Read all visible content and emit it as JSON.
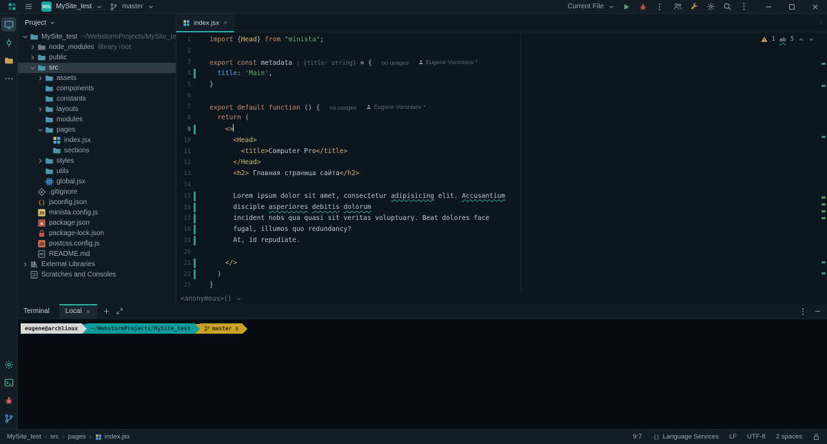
{
  "theme": {
    "accent": "#2BA9A2",
    "selection": "#2B3C46",
    "warning": "#D6AE58",
    "vcs_change": "#35948A",
    "typo_underline": "#3F9C8A"
  },
  "titlebar": {
    "left_icons": [
      {
        "name": "app-logo",
        "icon": "applogo",
        "color": "#2BA9A2"
      },
      {
        "name": "main-menu",
        "icon": "hamburger",
        "color": "#8C98A0"
      }
    ],
    "avatar": "MS",
    "project_name": "MySite_test",
    "branch": "master",
    "run_config": "Current File",
    "run_icons": [
      {
        "name": "run",
        "icon": "play",
        "color": "#4EA07C"
      },
      {
        "name": "debug",
        "icon": "bug",
        "color": "#C75450"
      },
      {
        "name": "run-more",
        "icon": "kebab",
        "color": "#8C98A0"
      }
    ],
    "right_icons": [
      {
        "name": "code-with-me",
        "icon": "users",
        "color": "#8C98A0"
      },
      {
        "name": "services",
        "icon": "wrench",
        "color": "#C78A3B"
      },
      {
        "name": "settings",
        "icon": "gear",
        "color": "#8C98A0"
      },
      {
        "name": "search-everywhere",
        "icon": "search",
        "color": "#8C98A0"
      },
      {
        "name": "more-actions",
        "icon": "kebab",
        "color": "#8C98A0"
      }
    ],
    "window_icons": [
      {
        "name": "minimize",
        "icon": "minus",
        "color": "#9AA6AE"
      },
      {
        "name": "maximize",
        "icon": "square",
        "color": "#9AA6AE"
      },
      {
        "name": "close-window",
        "icon": "close",
        "color": "#9AA6AE"
      }
    ]
  },
  "tool_stripe": {
    "top": [
      {
        "name": "project",
        "icon": "monitor",
        "color": "#5FA9D0",
        "active": true
      },
      {
        "name": "commit",
        "icon": "commit",
        "color": "#45B0A2"
      },
      {
        "name": "bookmarks",
        "icon": "folder",
        "color": "#C9A258"
      },
      {
        "name": "more-tools",
        "icon": "moreH",
        "color": "#7A858D"
      }
    ],
    "bottom": [
      {
        "name": "settings-sync",
        "icon": "gear",
        "color": "#45B0A2"
      },
      {
        "name": "terminal",
        "icon": "terminal",
        "color": "#57B88C"
      },
      {
        "name": "debug-tool",
        "icon": "bug",
        "color": "#DB5C5C"
      },
      {
        "name": "version-control",
        "icon": "branch",
        "color": "#56A8F5"
      }
    ]
  },
  "project_panel": {
    "title": "Project",
    "tree": [
      {
        "label": "MySite_test",
        "meta": "~/WebstormProjects/MySite_test",
        "depth": 0,
        "chevron": "down",
        "icon": "folder",
        "color": "#4E96A8"
      },
      {
        "label": "node_modules",
        "meta": "library root",
        "depth": 1,
        "chevron": "right",
        "icon": "folder",
        "color": "#6E7B84"
      },
      {
        "label": "public",
        "depth": 1,
        "chevron": "right",
        "icon": "folder",
        "color": "#4E96A8"
      },
      {
        "label": "src",
        "depth": 1,
        "chevron": "down",
        "icon": "folder",
        "color": "#4E96A8",
        "selected": true
      },
      {
        "label": "assets",
        "depth": 2,
        "chevron": "right",
        "icon": "folder",
        "color": "#4E96A8"
      },
      {
        "label": "components",
        "depth": 2,
        "icon": "folder",
        "color": "#4E96A8"
      },
      {
        "label": "constants",
        "depth": 2,
        "icon": "folder",
        "color": "#4E96A8"
      },
      {
        "label": "layouts",
        "depth": 2,
        "chevron": "right",
        "icon": "folder",
        "color": "#4E96A8"
      },
      {
        "label": "modules",
        "depth": 2,
        "icon": "folder",
        "color": "#4E96A8"
      },
      {
        "label": "pages",
        "depth": 2,
        "chevron": "down",
        "icon": "folder",
        "color": "#4E96A8"
      },
      {
        "label": "index.jsx",
        "depth": 3,
        "icon": "grid",
        "color": "#56A8F5"
      },
      {
        "label": "sections",
        "depth": 3,
        "icon": "folder",
        "color": "#4E96A8"
      },
      {
        "label": "styles",
        "depth": 2,
        "chevron": "right",
        "icon": "folder",
        "color": "#4E96A8"
      },
      {
        "label": "utils",
        "depth": 2,
        "icon": "folder",
        "color": "#4E96A8"
      },
      {
        "label": "global.jsx",
        "depth": 2,
        "icon": "atom",
        "color": "#56A8F5"
      },
      {
        "label": ".gitignore",
        "depth": 1,
        "icon": "gitFile",
        "color": "#8C98A0"
      },
      {
        "label": "jsconfig.json",
        "depth": 1,
        "icon": "braces",
        "color": "#D9A343"
      },
      {
        "label": "minista.config.js",
        "depth": 1,
        "icon": "jsFile",
        "color": "#D9C06B"
      },
      {
        "label": "package.json",
        "depth": 1,
        "icon": "npm",
        "color": "#B5564A"
      },
      {
        "label": "package-lock.json",
        "depth": 1,
        "icon": "lockFile",
        "color": "#C7584C"
      },
      {
        "label": "postcss.config.js",
        "depth": 1,
        "icon": "jsFile",
        "color": "#D06B52"
      },
      {
        "label": "README.md",
        "depth": 1,
        "icon": "mdFile",
        "color": "#7E9BB3"
      },
      {
        "label": "External Libraries",
        "depth": 0,
        "chevron": "right",
        "icon": "lib",
        "color": "#8C98A0"
      },
      {
        "label": "Scratches and Consoles",
        "depth": 0,
        "icon": "scratch",
        "color": "#8C98A0"
      }
    ]
  },
  "editor": {
    "tab_label": "index.jsx",
    "context_line": "<anonymous>()",
    "inspections": {
      "warning_count": "1",
      "typo_count": "5",
      "typo_glyph": "ab"
    },
    "scroll_marks": [
      {
        "t": 44,
        "c": "#35948A"
      },
      {
        "t": 76,
        "c": "#35948A"
      },
      {
        "t": 150,
        "c": "#35948A"
      },
      {
        "t": 238,
        "c": "#4F9E55"
      },
      {
        "t": 248,
        "c": "#4F9E55"
      },
      {
        "t": 258,
        "c": "#4F9E55"
      },
      {
        "t": 268,
        "c": "#4F9E55"
      },
      {
        "t": 332,
        "c": "#35948A"
      },
      {
        "t": 348,
        "c": "#35948A"
      }
    ],
    "code": {
      "lines": [
        {
          "n": "1",
          "t": [
            [
              "kw",
              "import"
            ],
            [
              "d",
              " "
            ],
            [
              "d",
              "{"
            ],
            [
              "cmp",
              "Head"
            ],
            [
              "d",
              "}"
            ],
            [
              "d",
              " "
            ],
            [
              "kw",
              "from"
            ],
            [
              "d",
              " "
            ],
            [
              "str",
              "\"minista\""
            ],
            [
              "d",
              ";"
            ]
          ]
        },
        {
          "n": "2",
          "t": []
        },
        {
          "n": "3",
          "t": [
            [
              "kw",
              "export"
            ],
            [
              "d",
              " "
            ],
            [
              "kw",
              "const"
            ],
            [
              "d",
              " metadata "
            ],
            [
              "hint",
              ": {title: string}"
            ],
            [
              "d",
              " = {"
            ]
          ],
          "inlays": [
            {
              "k": "usages",
              "text": "no usages"
            },
            {
              "k": "author",
              "text": "Eugene Vorontsov *"
            }
          ]
        },
        {
          "n": "4",
          "t": [
            [
              "d",
              "  "
            ],
            [
              "prop",
              "title"
            ],
            [
              "d",
              ": "
            ],
            [
              "str",
              "'Main'"
            ],
            [
              "d",
              ","
            ]
          ],
          "vcs": true
        },
        {
          "n": "5",
          "t": [
            [
              "d",
              "}"
            ]
          ]
        },
        {
          "n": "6",
          "t": []
        },
        {
          "n": "7",
          "t": [
            [
              "kw",
              "export"
            ],
            [
              "d",
              " "
            ],
            [
              "kw",
              "default"
            ],
            [
              "d",
              " "
            ],
            [
              "kw",
              "function"
            ],
            [
              "d",
              " () {"
            ]
          ],
          "inlays": [
            {
              "k": "usages",
              "text": "no usages"
            },
            {
              "k": "author",
              "text": "Eugene Vorontsov *"
            }
          ]
        },
        {
          "n": "8",
          "t": [
            [
              "d",
              "  "
            ],
            [
              "kw",
              "return"
            ],
            [
              "d",
              " ("
            ]
          ]
        },
        {
          "n": "9",
          "t": [
            [
              "d",
              "    "
            ],
            [
              "tag",
              "<>"
            ]
          ],
          "vcs": true,
          "caret": true
        },
        {
          "n": "10",
          "t": [
            [
              "d",
              "      "
            ],
            [
              "tag",
              "<Head>"
            ]
          ]
        },
        {
          "n": "11",
          "t": [
            [
              "d",
              "        "
            ],
            [
              "tag",
              "<title>"
            ],
            [
              "d",
              "Computer Pro"
            ],
            [
              "tag",
              "</title>"
            ]
          ]
        },
        {
          "n": "12",
          "t": [
            [
              "d",
              "      "
            ],
            [
              "tag",
              "</Head>"
            ]
          ]
        },
        {
          "n": "13",
          "t": [
            [
              "d",
              "      "
            ],
            [
              "tag",
              "<h2>"
            ],
            [
              "d",
              " Главная страница сайта"
            ],
            [
              "tag",
              "</h2>"
            ]
          ]
        },
        {
          "n": "14",
          "t": []
        },
        {
          "n": "15",
          "t": [
            [
              "d",
              "      Lorem ipsum dolor sit amet, consectetur "
            ],
            [
              "typo",
              "adipisicing"
            ],
            [
              "d",
              " elit. "
            ],
            [
              "typo",
              "Accusantium"
            ]
          ],
          "vcs": true
        },
        {
          "n": "16",
          "t": [
            [
              "d",
              "      disciple "
            ],
            [
              "typo",
              "asperiores"
            ],
            [
              "d",
              " "
            ],
            [
              "typo",
              "debitis"
            ],
            [
              "d",
              " "
            ],
            [
              "typo",
              "dolorum"
            ]
          ],
          "vcs": true
        },
        {
          "n": "17",
          "t": [
            [
              "d",
              "      incident nobs qua quasi sit veritas voluptuary. Beat dolores face"
            ]
          ],
          "vcs": true
        },
        {
          "n": "18",
          "t": [
            [
              "d",
              "      fugal, illumos quo redundancy?"
            ]
          ],
          "vcs": true
        },
        {
          "n": "19",
          "t": [
            [
              "d",
              "      At, id repudiate."
            ]
          ],
          "vcs": true
        },
        {
          "n": "20",
          "t": []
        },
        {
          "n": "21",
          "t": [
            [
              "d",
              "    "
            ],
            [
              "tag",
              "</>"
            ]
          ],
          "vcs": true
        },
        {
          "n": "22",
          "t": [
            [
              "d",
              "  )"
            ]
          ],
          "vcs": true
        },
        {
          "n": "23",
          "t": [
            [
              "d",
              "}"
            ]
          ]
        }
      ]
    }
  },
  "terminal": {
    "panel_title": "Terminal",
    "tab_label": "Local",
    "prompt": [
      {
        "text": "eugene@archlinux",
        "bg": "#D8D8D8",
        "fg": "#15191C"
      },
      {
        "text": "~/WebstormProjects/MySite_test",
        "bg": "#0E9D9D",
        "fg": "#05333A"
      },
      {
        "text": "master ±",
        "bg": "#C9A227",
        "fg": "#3A2E05",
        "icon": "branch"
      }
    ]
  },
  "statusbar": {
    "breadcrumbs": [
      "MySite_test",
      "src",
      "pages",
      "index.jsx"
    ],
    "caret": "9:7",
    "language_services": "Language Services",
    "line_separator": "LF",
    "encoding": "UTF-8",
    "indent": "2 spaces"
  }
}
